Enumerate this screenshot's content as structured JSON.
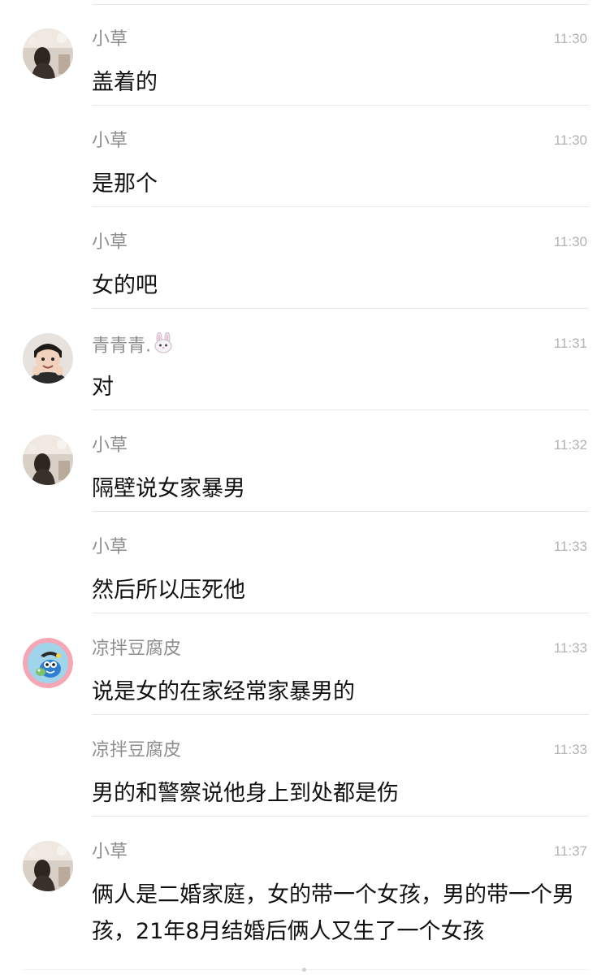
{
  "messages": [
    {
      "sender": "小草",
      "time": "11:30",
      "text": "盖着的",
      "avatar": "xiaocao-avatar"
    },
    {
      "sender": "小草",
      "time": "11:30",
      "text": "是那个"
    },
    {
      "sender": "小草",
      "time": "11:30",
      "text": "女的吧"
    },
    {
      "sender": "青青青.",
      "time": "11:31",
      "text": "对",
      "avatar": "qingqingqing-avatar",
      "emoji": "bunny-icon"
    },
    {
      "sender": "小草",
      "time": "11:32",
      "text": "隔壁说女家暴男",
      "avatar": "xiaocao-avatar"
    },
    {
      "sender": "小草",
      "time": "11:33",
      "text": "然后所以压死他"
    },
    {
      "sender": "凉拌豆腐皮",
      "time": "11:33",
      "text": "说是女的在家经常家暴男的",
      "avatar": "liangban-avatar"
    },
    {
      "sender": "凉拌豆腐皮",
      "time": "11:33",
      "text": "男的和警察说他身上到处都是伤"
    },
    {
      "sender": "小草",
      "time": "11:37",
      "text": "俩人是二婚家庭，女的带一个女孩，男的带一个男孩，21年8月结婚后俩人又生了一个女孩",
      "avatar": "xiaocao-avatar"
    }
  ]
}
